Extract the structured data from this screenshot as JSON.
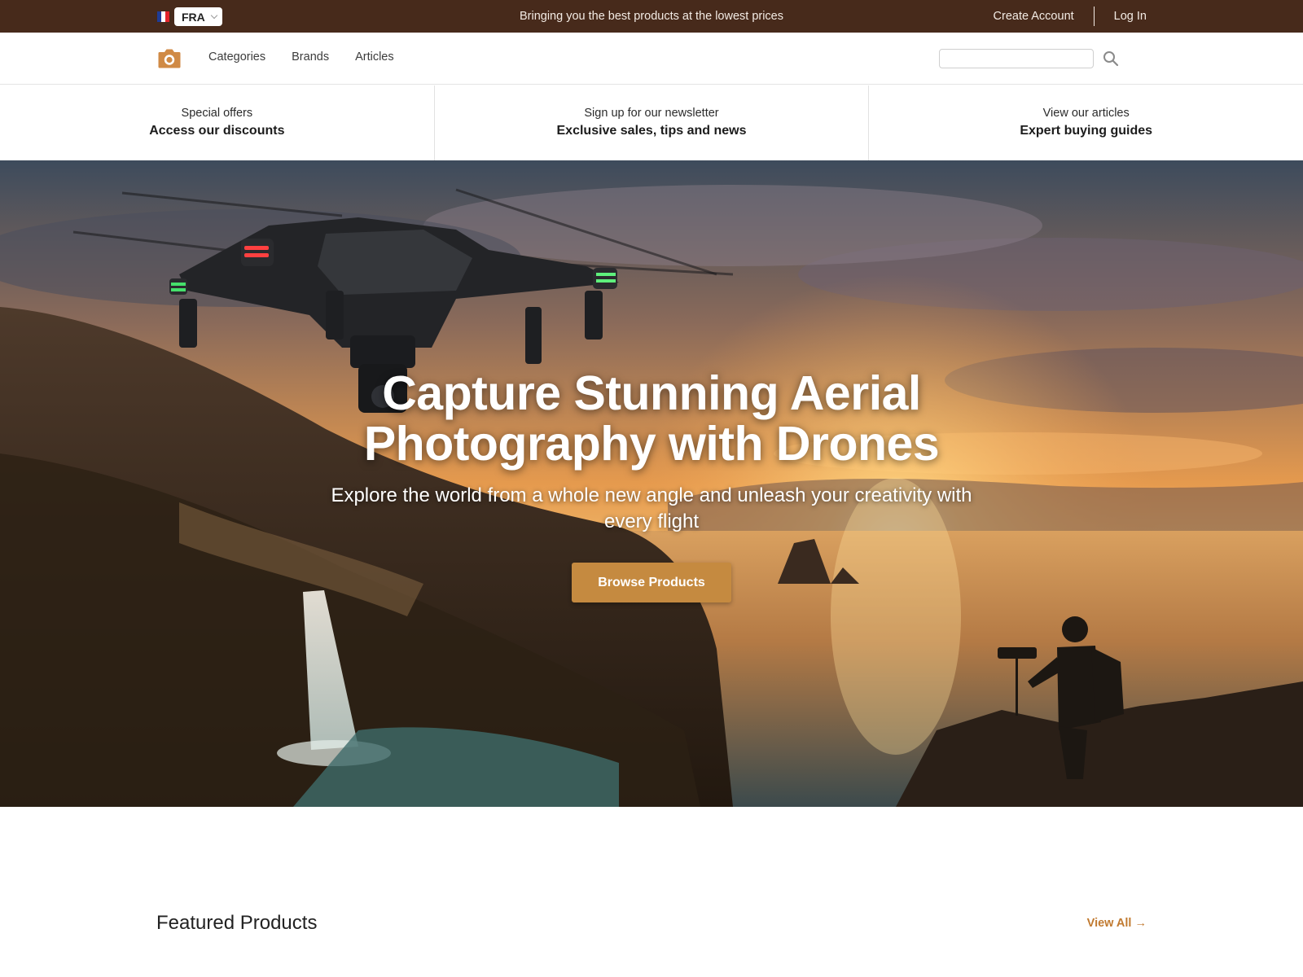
{
  "topbar": {
    "language": "FRA",
    "promo": "Bringing you the best products at the lowest prices",
    "create_account": "Create Account",
    "log_in": "Log In"
  },
  "nav": {
    "logo_icon": "camera-icon",
    "links": [
      "Categories",
      "Brands",
      "Articles"
    ],
    "search_placeholder": "",
    "search_icon": "search-icon"
  },
  "value_props": [
    {
      "small": "Special offers",
      "big": "Access our discounts"
    },
    {
      "small": "Sign up for our newsletter",
      "big": "Exclusive sales, tips and news"
    },
    {
      "small": "View our articles",
      "big": "Expert buying guides"
    }
  ],
  "hero": {
    "title_line1": "Capture Stunning Aerial",
    "title_line2": "Photography with Drones",
    "subtitle": "Explore the world from a whole new angle and unleash your creativity with every flight",
    "cta": "Browse Products"
  },
  "featured": {
    "title": "Featured Products",
    "view_all": "View All →"
  },
  "colors": {
    "topbar": "#472a1b",
    "accent": "#c58a40",
    "link_accent": "#c17a30",
    "logo": "#d08a45"
  }
}
